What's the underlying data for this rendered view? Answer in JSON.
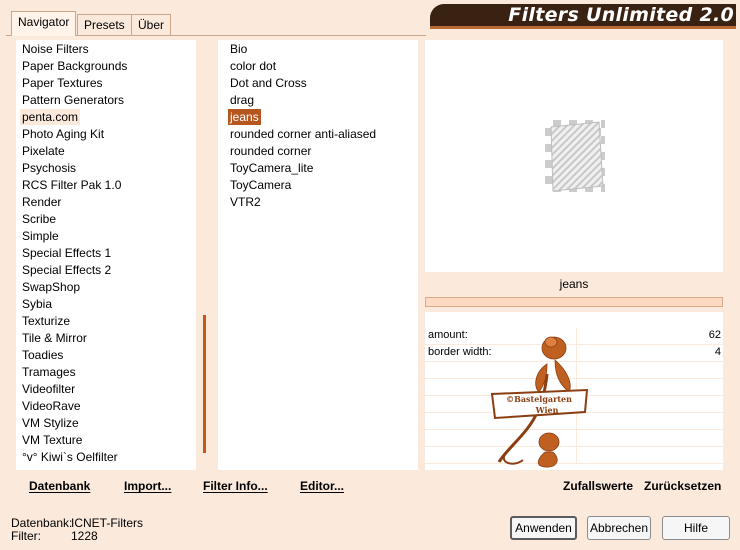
{
  "tabs": [
    {
      "label": "Navigator",
      "active": true
    },
    {
      "label": "Presets",
      "active": false
    },
    {
      "label": "Über",
      "active": false
    }
  ],
  "title": "Filters Unlimited 2.0",
  "categories": [
    "Noise Filters",
    "Paper Backgrounds",
    "Paper Textures",
    "Pattern Generators",
    "penta.com",
    "Photo Aging Kit",
    "Pixelate",
    "Psychosis",
    "RCS Filter Pak 1.0",
    "Render",
    "Scribe",
    "Simple",
    "Special Effects 1",
    "Special Effects 2",
    "SwapShop",
    "Sybia",
    "Texturize",
    "Tile & Mirror",
    "Toadies",
    "Tramages",
    "Videofilter",
    "VideoRave",
    "VM Stylize",
    "VM Texture",
    "°v° Kiwi`s Oelfilter"
  ],
  "selected_category": "penta.com",
  "filters": [
    "Bio",
    "color dot",
    "Dot and Cross",
    "drag",
    "jeans",
    "rounded corner anti-aliased",
    "rounded corner",
    "ToyCamera_lite",
    "ToyCamera",
    "VTR2"
  ],
  "selected_filter": "jeans",
  "preview_filter_name": "jeans",
  "params": [
    {
      "label": "amount:",
      "value": "62"
    },
    {
      "label": "border width:",
      "value": "4"
    },
    {
      "label": "",
      "value": ""
    },
    {
      "label": "",
      "value": ""
    },
    {
      "label": "",
      "value": ""
    },
    {
      "label": "",
      "value": ""
    },
    {
      "label": "",
      "value": ""
    },
    {
      "label": "",
      "value": ""
    }
  ],
  "watermark_text": "©Bastelgarten Wien",
  "bottom_links": {
    "datenbank": "Datenbank",
    "import": "Import...",
    "filter_info": "Filter Info...",
    "editor": "Editor...",
    "zufallswerte": "Zufallswerte",
    "zuruecksetzen": "Zurücksetzen"
  },
  "status": {
    "db_label": "Datenbank:",
    "db_value": "ICNET-Filters",
    "filter_label": "Filter:",
    "filter_value": "1228"
  },
  "buttons": {
    "apply": "Anwenden",
    "cancel": "Abbrechen",
    "help": "Hilfe"
  },
  "colors": {
    "background": "#fbe9dc",
    "accent": "#b5561e",
    "titlebar": "#3a2213"
  }
}
